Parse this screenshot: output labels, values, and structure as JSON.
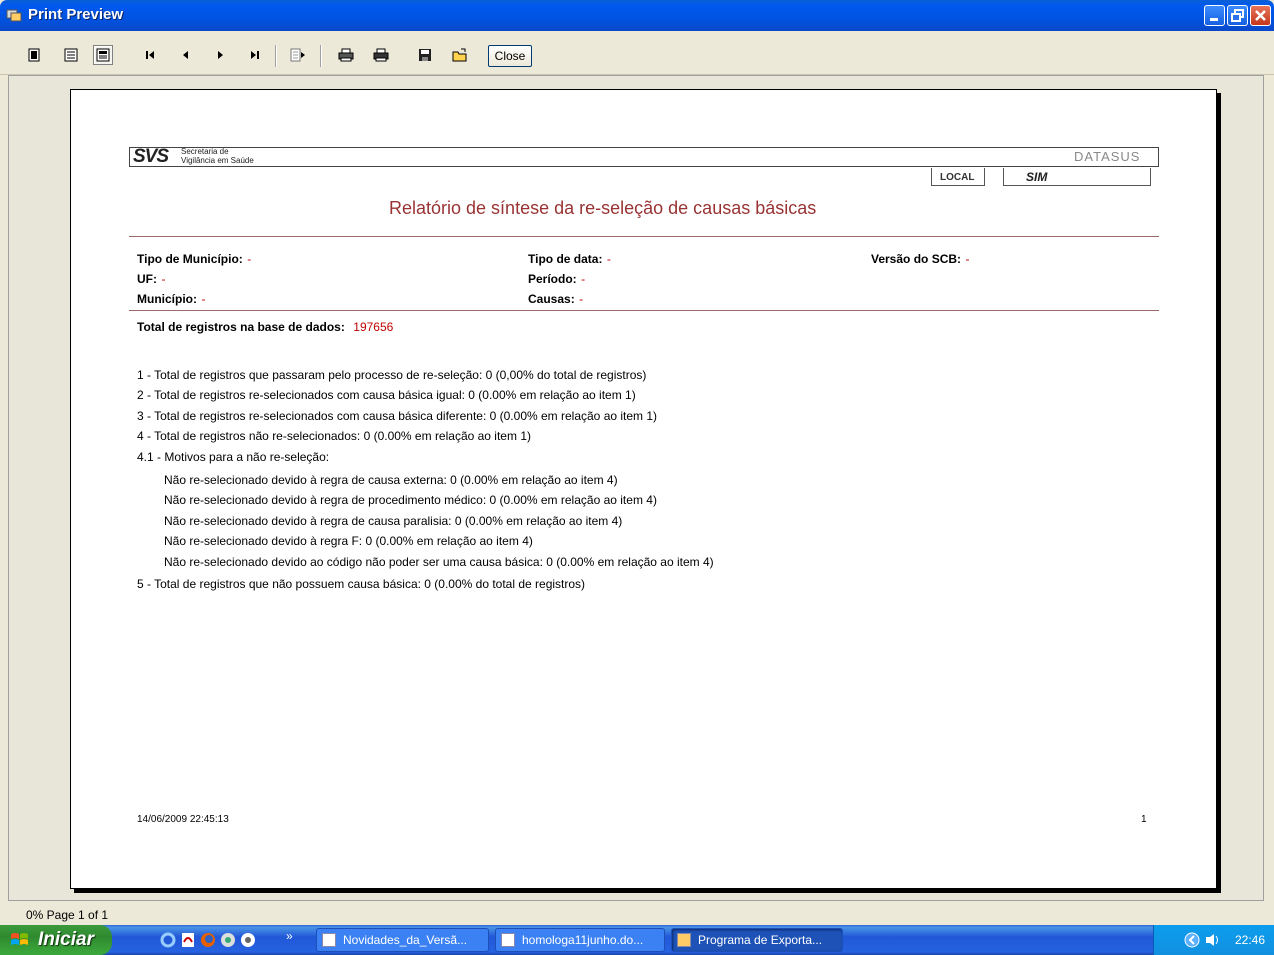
{
  "window": {
    "title": "Print Preview"
  },
  "toolbar": {
    "close_label": "Close"
  },
  "report": {
    "org_name_line1": "Secretaria de",
    "org_name_line2": "Vigilância em Saúde",
    "logo_svs": "SVS",
    "logo_datasus": "DATASUS",
    "logo_local": "LOCAL",
    "logo_sim": "SIM",
    "title": "Relatório de síntese da re-seleção de causas básicas",
    "fields": {
      "tipo_municipio_label": "Tipo de Município:",
      "tipo_municipio_value": "-",
      "uf_label": "UF:",
      "uf_value": "-",
      "municipio_label": "Município:",
      "municipio_value": "-",
      "tipo_data_label": "Tipo de data:",
      "tipo_data_value": "-",
      "periodo_label": "Período:",
      "periodo_value": "-",
      "causas_label": "Causas:",
      "causas_value": "-",
      "versao_scb_label": "Versão do SCB:",
      "versao_scb_value": "-"
    },
    "total_label": "Total de registros na base de dados:",
    "total_value": "197656",
    "lines": [
      "1 - Total de registros que passaram pelo processo de re-seleção: 0 (0,00% do total de registros)",
      "2 - Total de registros re-selecionados com causa básica igual: 0 (0.00% em relação ao item 1)",
      "3 - Total de registros re-selecionados com causa básica diferente: 0 (0.00% em relação ao item 1)",
      "4 - Total de registros não re-selecionados: 0 (0.00% em relação ao item 1)",
      "4.1 - Motivos para a não re-seleção:"
    ],
    "sub_lines": [
      "Não re-selecionado devido à regra de causa externa: 0 (0.00% em relação ao item 4)",
      "Não re-selecionado devido à regra de procedimento médico: 0 (0.00% em relação ao item 4)",
      "Não re-selecionado devido à regra de causa paralisia: 0 (0.00% em relação ao item 4)",
      "Não re-selecionado devido à regra F: 0 (0.00% em relação ao item 4)",
      "Não re-selecionado devido ao código não poder ser uma causa básica: 0 (0.00% em relação ao item 4)"
    ],
    "last_line": "5 - Total de registros que não possuem causa básica: 0 (0.00% do total de registros)",
    "footer_datetime": "14/06/2009 22:45:13",
    "footer_page": "1"
  },
  "status": {
    "text": "0% Page 1 of 1"
  },
  "taskbar": {
    "start_label": "Iniciar",
    "tasks": [
      "Novidades_da_Versã...",
      "homologa11junho.do...",
      "Programa de Exporta..."
    ],
    "clock": "22:46"
  },
  "colors": {
    "accent_red": "#c00000",
    "title_red": "#993333",
    "titlebar_blue": "#0058ee"
  }
}
